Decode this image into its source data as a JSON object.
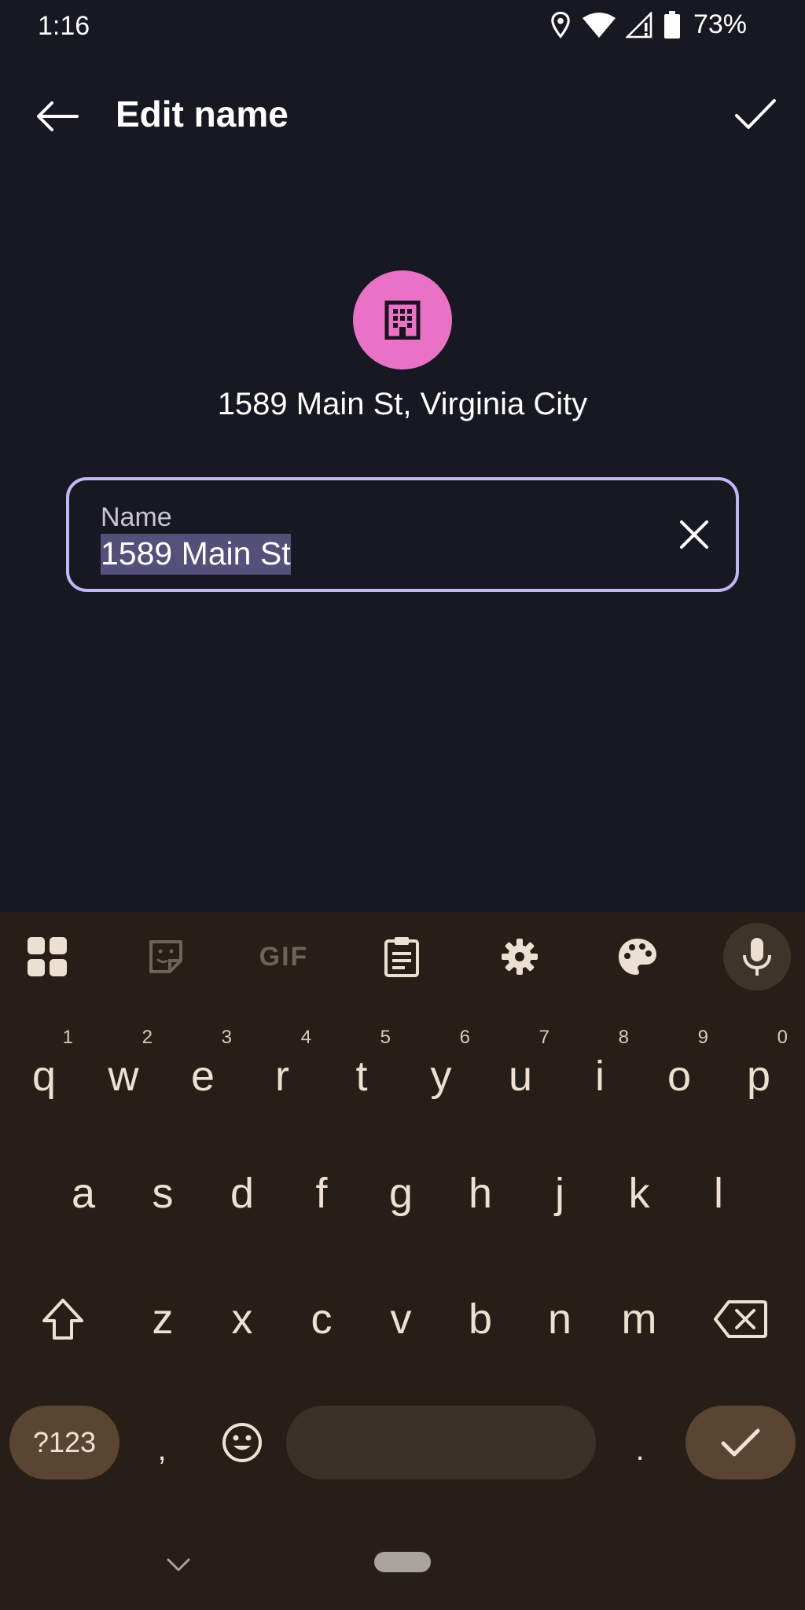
{
  "status_bar": {
    "time": "1:16",
    "battery": "73%",
    "icons": [
      "location-icon",
      "wifi-icon",
      "signal-icon",
      "battery-icon"
    ]
  },
  "app_bar": {
    "title": "Edit name",
    "back_icon": "arrow-left-icon",
    "confirm_icon": "check-icon"
  },
  "place": {
    "icon": "building-icon",
    "avatar_color": "#ea72c6",
    "address": "1589 Main St, Virginia City"
  },
  "name_field": {
    "label": "Name",
    "value": "1589 Main St",
    "value_selected": true,
    "border_color": "#c1b7f3",
    "clear_icon": "close-icon"
  },
  "keyboard": {
    "toolbar": [
      "apps-grid-icon",
      "sticker-icon",
      "gif-icon",
      "clipboard-icon",
      "settings-gear-icon",
      "palette-icon",
      "microphone-icon"
    ],
    "gif_label": "GIF",
    "row1": [
      {
        "key": "q",
        "hint": "1"
      },
      {
        "key": "w",
        "hint": "2"
      },
      {
        "key": "e",
        "hint": "3"
      },
      {
        "key": "r",
        "hint": "4"
      },
      {
        "key": "t",
        "hint": "5"
      },
      {
        "key": "y",
        "hint": "6"
      },
      {
        "key": "u",
        "hint": "7"
      },
      {
        "key": "i",
        "hint": "8"
      },
      {
        "key": "o",
        "hint": "9"
      },
      {
        "key": "p",
        "hint": "0"
      }
    ],
    "row2": [
      "a",
      "s",
      "d",
      "f",
      "g",
      "h",
      "j",
      "k",
      "l"
    ],
    "row3": [
      "z",
      "x",
      "c",
      "v",
      "b",
      "n",
      "m"
    ],
    "bottom": {
      "symbols": "?123",
      "comma": ",",
      "period": "."
    },
    "background": "#271f17"
  }
}
